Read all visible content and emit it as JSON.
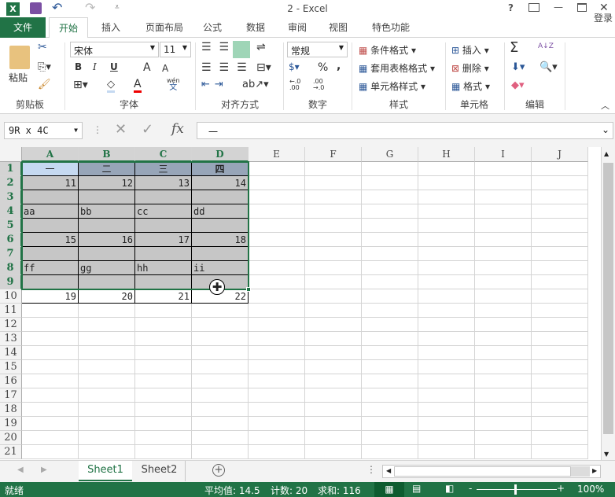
{
  "title": "2 - Excel",
  "title_controls": {
    "help": "?",
    "restore_ribbon": "⊼",
    "minimize": "—",
    "maximize": "☐",
    "close": "✕"
  },
  "qat": {
    "undo": "↶",
    "redo": "↷"
  },
  "tabs": [
    {
      "label": "文件"
    },
    {
      "label": "开始"
    },
    {
      "label": "插入"
    },
    {
      "label": "页面布局"
    },
    {
      "label": "公式"
    },
    {
      "label": "数据"
    },
    {
      "label": "审阅"
    },
    {
      "label": "视图"
    },
    {
      "label": "特色功能"
    }
  ],
  "login": "登录",
  "ribbon": {
    "clipboard": {
      "paste": "粘贴",
      "group": "剪贴板"
    },
    "font": {
      "name": "宋体",
      "size": "11",
      "bold": "B",
      "italic": "I",
      "underline": "U",
      "grow": "A",
      "shrink": "A",
      "font_color": "A",
      "phonetic_top": "wén",
      "phonetic_bottom": "文",
      "group": "字体"
    },
    "align": {
      "group": "对齐方式"
    },
    "number": {
      "format": "常规",
      "percent": "%",
      "comma": ",",
      "inc": "←.0\n.00",
      "dec": ".00\n→.0",
      "group": "数字"
    },
    "styles": {
      "conditional": "条件格式",
      "table": "套用表格格式",
      "cell": "单元格样式",
      "group": "样式"
    },
    "cells": {
      "insert": "插入",
      "delete": "删除",
      "format": "格式",
      "group": "单元格"
    },
    "editing": {
      "sum": "Σ",
      "sort": "A↓Z",
      "group": "编辑"
    }
  },
  "formula_bar": {
    "name_box": "9R x 4C",
    "cancel": "✕",
    "enter": "✓",
    "fx": "fx",
    "value": "一"
  },
  "columns": [
    "A",
    "B",
    "C",
    "D",
    "E",
    "F",
    "G",
    "H",
    "I",
    "J"
  ],
  "rows": [
    "1",
    "2",
    "3",
    "4",
    "5",
    "6",
    "7",
    "8",
    "9",
    "10",
    "11",
    "12",
    "13",
    "14",
    "15",
    "16",
    "17",
    "18",
    "19",
    "20",
    "21"
  ],
  "cells": [
    [
      "一",
      "二",
      "三",
      "四"
    ],
    [
      "11",
      "12",
      "13",
      "14"
    ],
    [
      "",
      "",
      "",
      ""
    ],
    [
      "aa",
      "bb",
      "cc",
      "dd"
    ],
    [
      "",
      "",
      "",
      ""
    ],
    [
      "15",
      "16",
      "17",
      "18"
    ],
    [
      "",
      "",
      "",
      ""
    ],
    [
      "ff",
      "gg",
      "hh",
      "ii"
    ],
    [
      "",
      "",
      "",
      ""
    ],
    [
      "19",
      "20",
      "21",
      "22"
    ]
  ],
  "sheets": [
    {
      "label": "Sheet1",
      "active": true
    },
    {
      "label": "Sheet2",
      "active": false
    }
  ],
  "status": {
    "ready": "就绪",
    "average": "平均值: 14.5",
    "count": "计数: 20",
    "sum": "求和: 116",
    "zoom": "100%"
  },
  "colors": {
    "excel_green": "#217346",
    "selection_gray": "#c6c6c6",
    "header_blue": "#97a5b8",
    "active_cell": "#c5d9f1"
  }
}
